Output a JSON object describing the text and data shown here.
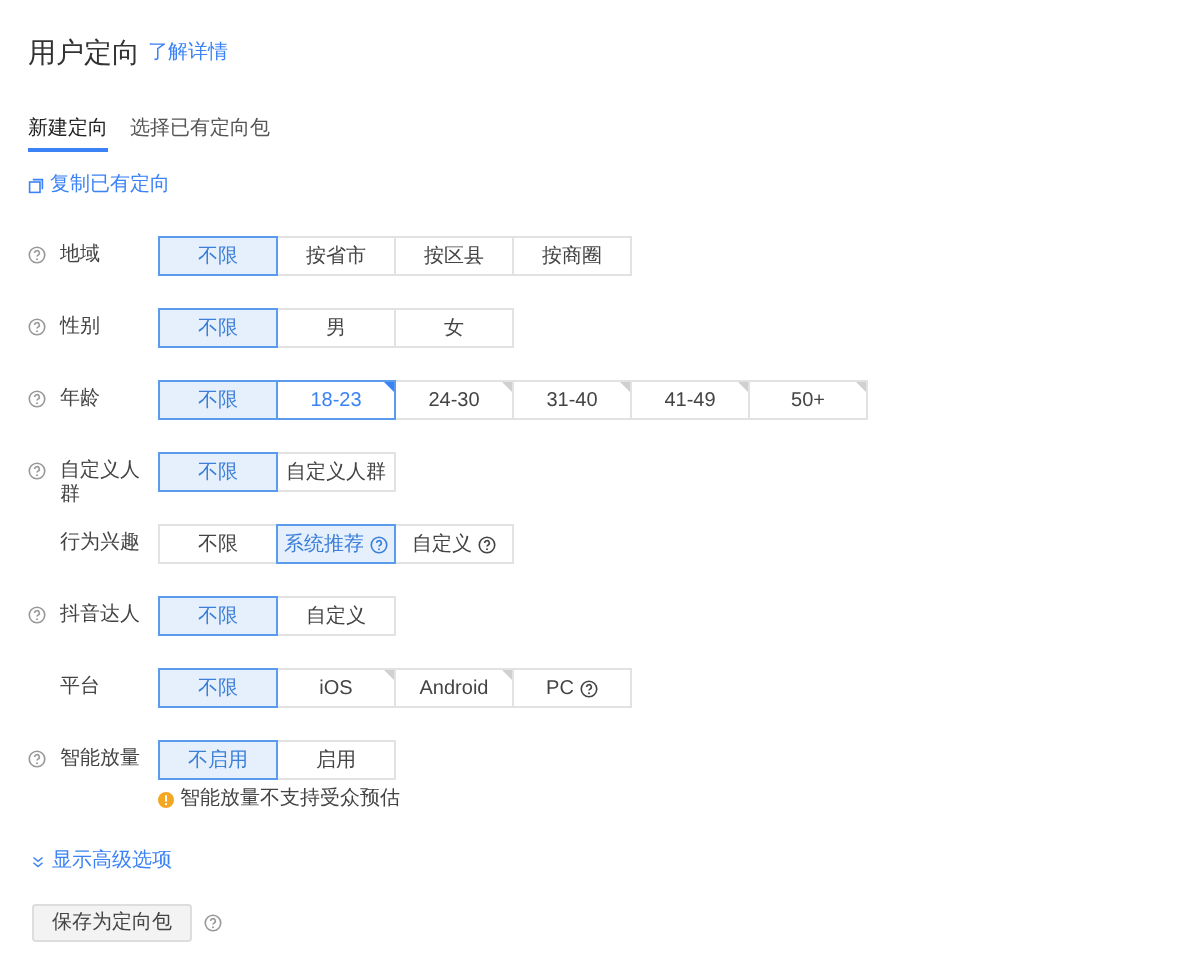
{
  "title": "用户定向",
  "title_link": "了解详情",
  "tabs": [
    {
      "label": "新建定向",
      "selected": true
    },
    {
      "label": "选择已有定向包",
      "selected": false
    }
  ],
  "copy_link": "复制已有定向",
  "rows": [
    {
      "label": "地域",
      "help": true,
      "options": [
        {
          "label": "不限",
          "selected": true
        },
        {
          "label": "按省市",
          "selected": false
        },
        {
          "label": "按区县",
          "selected": false
        },
        {
          "label": "按商圈",
          "selected": false
        }
      ]
    },
    {
      "label": "性别",
      "help": true,
      "options": [
        {
          "label": "不限",
          "selected": true
        },
        {
          "label": "男",
          "selected": false
        },
        {
          "label": "女",
          "selected": false
        }
      ]
    },
    {
      "label": "年龄",
      "help": true,
      "options": [
        {
          "label": "不限",
          "selected": true
        },
        {
          "label": "18-23",
          "selected": false,
          "focused": true,
          "corner": true
        },
        {
          "label": "24-30",
          "selected": false,
          "corner": true
        },
        {
          "label": "31-40",
          "selected": false,
          "corner": true
        },
        {
          "label": "41-49",
          "selected": false,
          "corner": true
        },
        {
          "label": "50+",
          "selected": false,
          "corner": true
        }
      ]
    },
    {
      "label": "自定义人群",
      "help": true,
      "options": [
        {
          "label": "不限",
          "selected": true
        },
        {
          "label": "自定义人群",
          "selected": false
        }
      ]
    },
    {
      "label": "行为兴趣",
      "help": false,
      "options": [
        {
          "label": "不限",
          "selected": false
        },
        {
          "label": "系统推荐",
          "selected": true,
          "help": true
        },
        {
          "label": "自定义",
          "selected": false,
          "help": true
        }
      ]
    },
    {
      "label": "抖音达人",
      "help": true,
      "options": [
        {
          "label": "不限",
          "selected": true
        },
        {
          "label": "自定义",
          "selected": false
        }
      ]
    },
    {
      "label": "平台",
      "help": false,
      "options": [
        {
          "label": "不限",
          "selected": true
        },
        {
          "label": "iOS",
          "selected": false,
          "corner": true
        },
        {
          "label": "Android",
          "selected": false,
          "corner": true
        },
        {
          "label": "PC",
          "selected": false,
          "help": true
        }
      ]
    },
    {
      "label": "智能放量",
      "help": true,
      "options": [
        {
          "label": "不启用",
          "selected": true
        },
        {
          "label": "启用",
          "selected": false
        }
      ],
      "note": "智能放量不支持受众预估"
    }
  ],
  "advanced_link": "显示高级选项",
  "save_button": "保存为定向包"
}
